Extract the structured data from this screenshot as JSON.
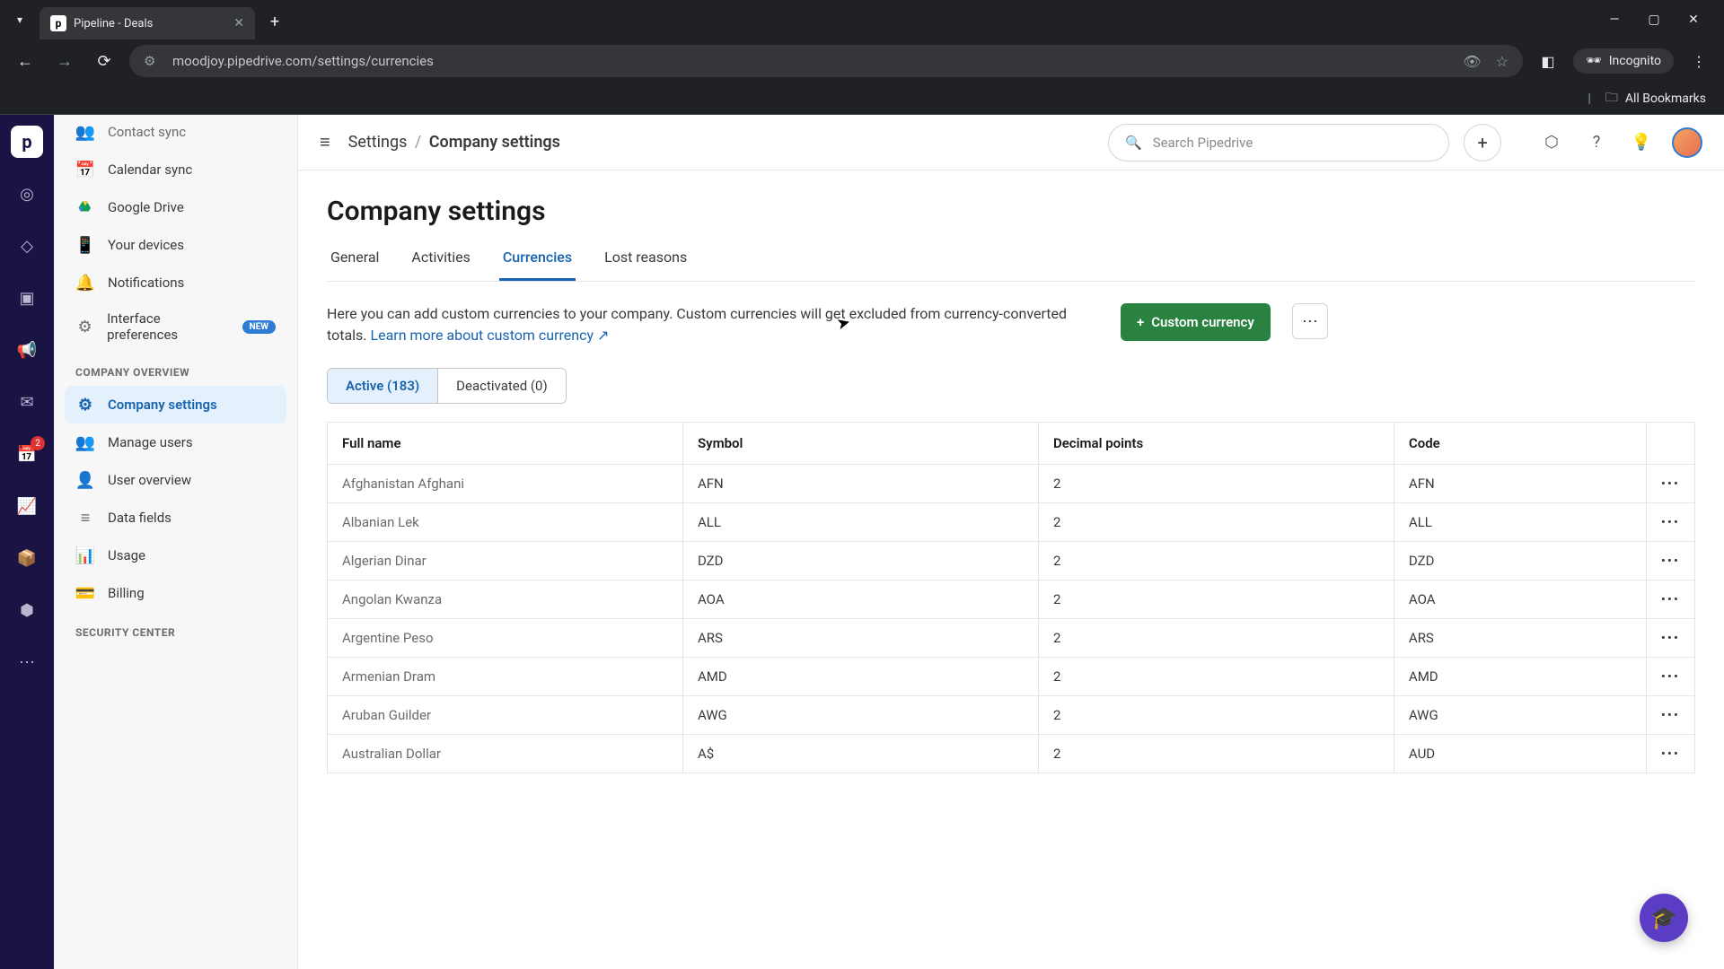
{
  "browser": {
    "tab_title": "Pipeline - Deals",
    "url": "moodjoy.pipedrive.com/settings/currencies",
    "incognito_label": "Incognito",
    "bookmarks_label": "All Bookmarks"
  },
  "rail": {
    "badge_count": "2"
  },
  "sidebar": {
    "items": [
      {
        "label": "Contact sync",
        "icon": "👥",
        "cut": true
      },
      {
        "label": "Calendar sync",
        "icon": "📅"
      },
      {
        "label": "Google Drive",
        "icon": "gd"
      },
      {
        "label": "Your devices",
        "icon": "📱"
      },
      {
        "label": "Notifications",
        "icon": "🔔"
      },
      {
        "label": "Interface preferences",
        "icon": "⚙",
        "new": true
      }
    ],
    "new_pill": "NEW",
    "section_overview": "COMPANY OVERVIEW",
    "overview_items": [
      {
        "label": "Company settings",
        "icon": "⚙",
        "selected": true
      },
      {
        "label": "Manage users",
        "icon": "👥"
      },
      {
        "label": "User overview",
        "icon": "👤"
      },
      {
        "label": "Data fields",
        "icon": "≡"
      },
      {
        "label": "Usage",
        "icon": "📊"
      },
      {
        "label": "Billing",
        "icon": "💳"
      }
    ],
    "section_security": "SECURITY CENTER"
  },
  "header": {
    "breadcrumb_root": "Settings",
    "breadcrumb_current": "Company settings",
    "search_placeholder": "Search Pipedrive"
  },
  "page": {
    "title": "Company settings",
    "tabs": [
      "General",
      "Activities",
      "Currencies",
      "Lost reasons"
    ],
    "active_tab_index": 2,
    "description": "Here you can add custom currencies to your company. Custom currencies will get excluded from currency-converted totals. ",
    "learn_more": "Learn more about custom currency",
    "custom_currency_btn": "Custom currency",
    "seg_active": "Active (183)",
    "seg_deactivated": "Deactivated (0)"
  },
  "table": {
    "columns": [
      "Full name",
      "Symbol",
      "Decimal points",
      "Code"
    ],
    "rows": [
      {
        "name": "Afghanistan Afghani",
        "symbol": "AFN",
        "decimals": "2",
        "code": "AFN"
      },
      {
        "name": "Albanian Lek",
        "symbol": "ALL",
        "decimals": "2",
        "code": "ALL"
      },
      {
        "name": "Algerian Dinar",
        "symbol": "DZD",
        "decimals": "2",
        "code": "DZD"
      },
      {
        "name": "Angolan Kwanza",
        "symbol": "AOA",
        "decimals": "2",
        "code": "AOA"
      },
      {
        "name": "Argentine Peso",
        "symbol": "ARS",
        "decimals": "2",
        "code": "ARS"
      },
      {
        "name": "Armenian Dram",
        "symbol": "AMD",
        "decimals": "2",
        "code": "AMD"
      },
      {
        "name": "Aruban Guilder",
        "symbol": "AWG",
        "decimals": "2",
        "code": "AWG"
      },
      {
        "name": "Australian Dollar",
        "symbol": "A$",
        "decimals": "2",
        "code": "AUD"
      }
    ]
  }
}
